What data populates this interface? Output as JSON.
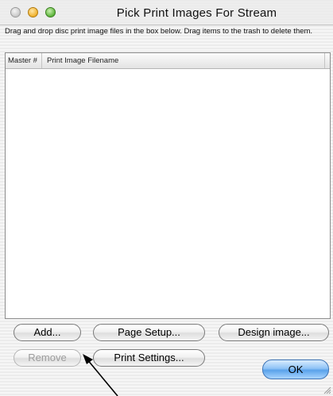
{
  "window": {
    "title": "Pick Print Images  For Stream"
  },
  "instructions": "Drag and drop disc print image files in the box below. Drag items to the trash to delete them.",
  "list": {
    "columns": [
      "Master #",
      "Print Image Filename"
    ],
    "rows": []
  },
  "buttons": {
    "add": "Add...",
    "page_setup": "Page Setup...",
    "design_image": "Design image...",
    "remove": "Remove",
    "print_settings": "Print Settings...",
    "ok": "OK"
  },
  "icons": {
    "close": "close-button-icon",
    "minimize": "minimize-button-icon",
    "zoom": "zoom-button-icon",
    "resize": "resize-grip-icon",
    "annotation": "annotation-arrow"
  }
}
